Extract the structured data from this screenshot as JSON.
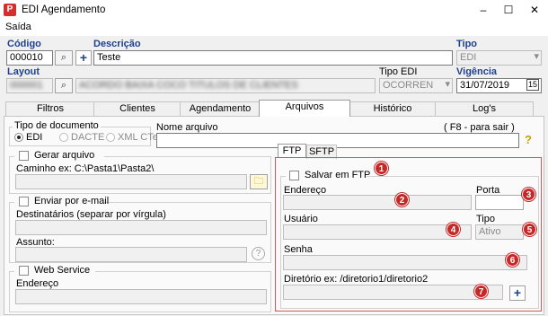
{
  "window": {
    "title": "EDI Agendamento",
    "app_icon_letter": "P",
    "minimize": "–",
    "maximize": "☐",
    "close": "✕"
  },
  "menu": {
    "items": [
      "Saída"
    ]
  },
  "header": {
    "codigo_label": "Código",
    "codigo_value": "000010",
    "descricao_label": "Descrição",
    "descricao_value": "Teste",
    "tipo_label": "Tipo",
    "tipo_value": "EDI",
    "layout_label": "Layout",
    "layout_value": "000001",
    "layout_desc": "ACORDO BAIXA COCO TITULOS DE CLIENTES",
    "tipo_edi_label": "Tipo EDI",
    "tipo_edi_value": "OCORREN",
    "vigencia_label": "Vigência",
    "vigencia_value": "31/07/2019"
  },
  "tabs": [
    "Filtros",
    "Clientes",
    "Agendamento",
    "Arquivos",
    "Histórico",
    "Log's"
  ],
  "active_tab": "Arquivos",
  "left": {
    "tipo_documento_label": "Tipo de documento",
    "tipo_documento_options": [
      "EDI",
      "DACTE",
      "XML CTe"
    ],
    "nome_arquivo_label": "Nome arquivo",
    "hint": "( F8 - para sair )",
    "help_glyph": "?",
    "gerar_arquivo_label": "Gerar arquivo",
    "caminho_label": "Caminho ex: C:\\Pasta1\\Pasta2\\",
    "enviar_email_label": "Enviar por e-mail",
    "destinatarios_label": "Destinatários (separar por vírgula)",
    "assunto_label": "Assunto:",
    "web_service_label": "Web Service",
    "endereco_label": "Endereço"
  },
  "ftp": {
    "subtabs": [
      "FTP",
      "SFTP"
    ],
    "salvar_label": "Salvar em FTP",
    "endereco_label": "Endereço",
    "porta_label": "Porta",
    "usuario_label": "Usuário",
    "tipo_label": "Tipo",
    "tipo_value": "Ativo",
    "senha_label": "Senha",
    "diretorio_label": "Diretório ex: /diretorio1/diretorio2",
    "badges": [
      "1",
      "2",
      "3",
      "4",
      "5",
      "6",
      "7"
    ],
    "plus_glyph": "+"
  },
  "colors": {
    "label_blue": "#1f3f8f",
    "badge_red": "#c62828",
    "highlight_border": "#d9534f"
  },
  "icons": {
    "folder": "folder-icon",
    "binoculars": "binoculars-icon",
    "calendar": "calendar-icon",
    "help": "help-icon"
  }
}
